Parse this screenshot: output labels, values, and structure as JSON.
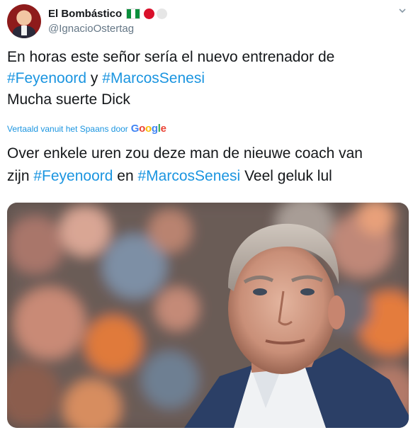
{
  "author": {
    "name": "El Bombástico",
    "handle": "@IgnacioOstertag",
    "flag_colors": [
      "#0a8f3c",
      "#ffffff",
      "#0a8f3c"
    ],
    "dot_colors": [
      "#d9102b",
      "#e6e6e6"
    ]
  },
  "tweet": {
    "line1": "En horas este señor sería el nuevo entrenador de",
    "tag1": "#Feyenoord",
    "connector": "y",
    "tag2": "#MarcosSenesi",
    "line3": "Mucha suerte Dick"
  },
  "translation": {
    "label": "Vertaald vanuit het Spaans door",
    "provider": "Google",
    "line1": "Over enkele uren zou deze man de nieuwe coach van",
    "prefix": "zijn",
    "tag1": "#Feyenoord",
    "connector": "en",
    "tag2": "#MarcosSenesi",
    "suffix": "Veel geluk lul"
  },
  "colors": {
    "link": "#1b95e0",
    "text": "#14171a",
    "secondary": "#657786"
  },
  "icons": {
    "menu": "chevron-down-icon",
    "avatar": "avatar",
    "photo": "tweet-photo"
  }
}
